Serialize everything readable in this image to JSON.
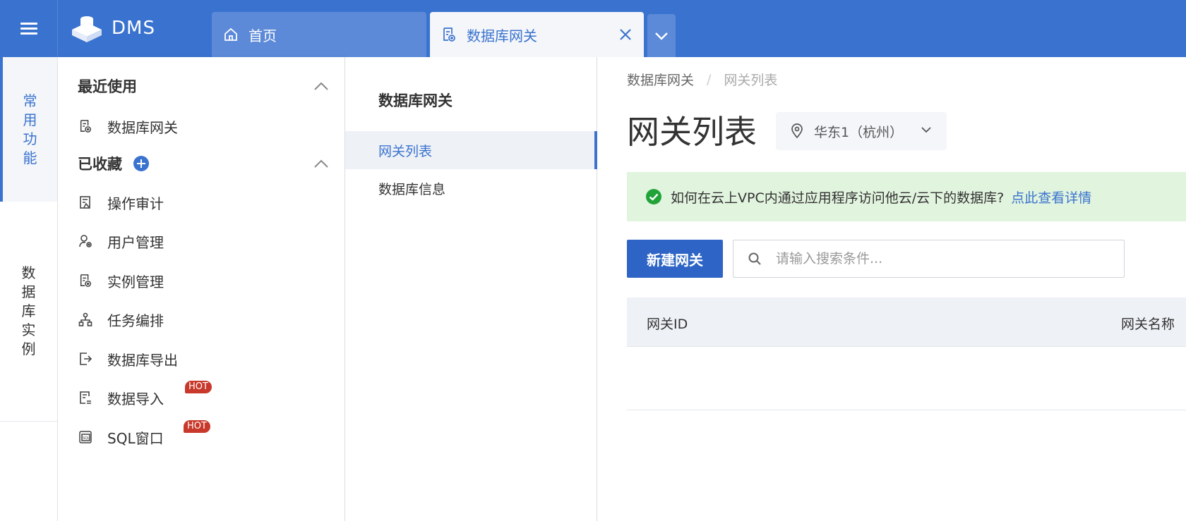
{
  "app": {
    "name": "DMS"
  },
  "tabs": [
    {
      "label": "首页",
      "icon": "home-icon"
    },
    {
      "label": "数据库网关",
      "icon": "database-gateway-icon",
      "active": true
    }
  ],
  "rail": {
    "items": [
      {
        "label": "常用功能",
        "chars": [
          "常",
          "用",
          "功",
          "能"
        ],
        "active": true
      },
      {
        "label": "数据库实例",
        "chars": [
          "数",
          "据",
          "库",
          "实",
          "例"
        ]
      }
    ]
  },
  "nav": {
    "recent": {
      "title": "最近使用",
      "items": [
        {
          "label": "数据库网关",
          "icon": "database-gateway-icon"
        }
      ]
    },
    "favorites": {
      "title": "已收藏",
      "items": [
        {
          "label": "操作审计",
          "icon": "audit-icon"
        },
        {
          "label": "用户管理",
          "icon": "user-manage-icon"
        },
        {
          "label": "实例管理",
          "icon": "instance-manage-icon"
        },
        {
          "label": "任务编排",
          "icon": "task-flow-icon"
        },
        {
          "label": "数据库导出",
          "icon": "export-icon"
        },
        {
          "label": "数据导入",
          "icon": "import-icon",
          "badge": "HOT"
        },
        {
          "label": "SQL窗口",
          "icon": "sql-window-icon",
          "badge": "HOT"
        }
      ]
    }
  },
  "submenu": {
    "title": "数据库网关",
    "items": [
      {
        "label": "网关列表",
        "active": true
      },
      {
        "label": "数据库信息"
      }
    ]
  },
  "main": {
    "breadcrumb": [
      "数据库网关",
      "网关列表"
    ],
    "breadcrumb_sep": "/",
    "title": "网关列表",
    "region": "华东1（杭州）",
    "notice": {
      "text": "如何在云上VPC内通过应用程序访问他云/云下的数据库?",
      "link": "点此查看详情"
    },
    "new_button": "新建网关",
    "search_placeholder": "请输入搜索条件...",
    "table": {
      "columns": [
        "网关ID",
        "网关名称"
      ]
    }
  },
  "colors": {
    "primary": "#3a73cf",
    "hot": "#c8382b",
    "notice_bg": "#e1f4de",
    "success": "#22a33a"
  }
}
